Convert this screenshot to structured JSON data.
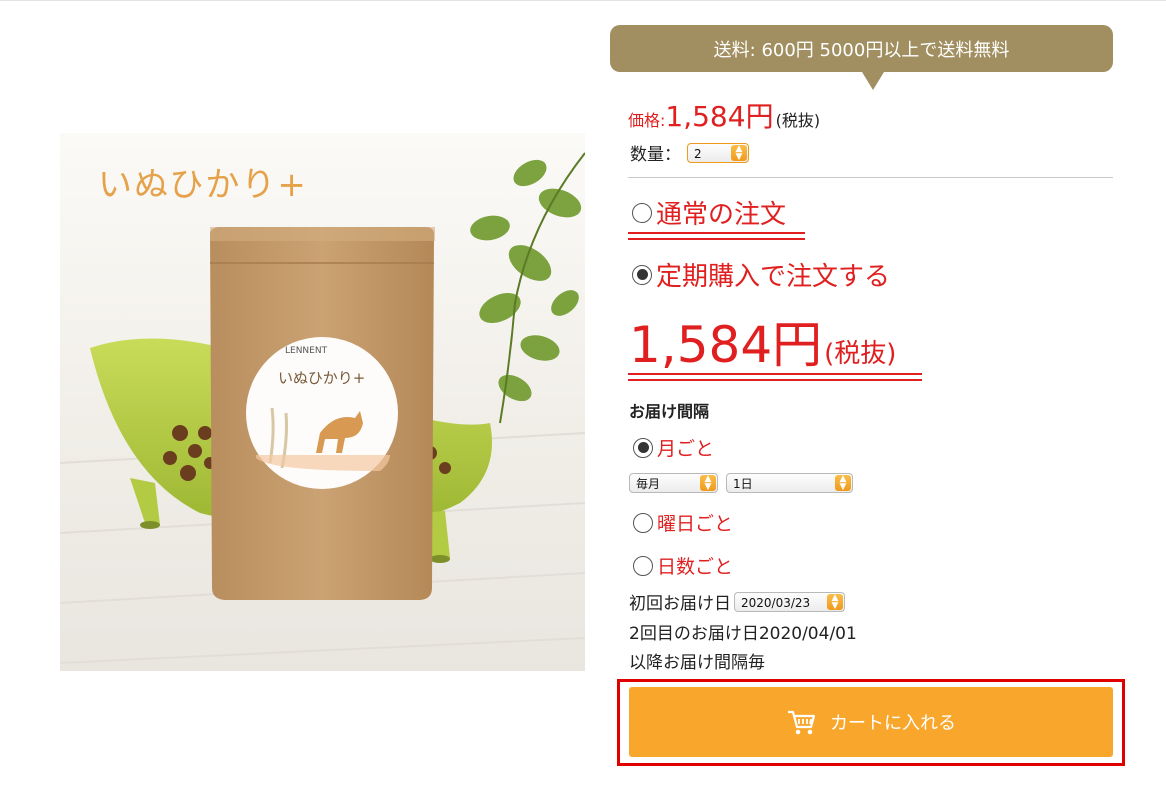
{
  "product": {
    "image_title": "いぬひかり+",
    "package_brand": "LENNENT",
    "package_name": "いぬひかり+"
  },
  "shipping": {
    "text": "送料: 600円 5000円以上で送料無料"
  },
  "price": {
    "label": "価格:",
    "value": "1,584円",
    "tax": "(税抜)"
  },
  "quantity": {
    "label": "数量：",
    "value": "2"
  },
  "order_type": {
    "normal_label": "通常の注文",
    "subscription_label": "定期購入で注文する",
    "selected": "subscription"
  },
  "subscription_price": {
    "amount": "1,584円",
    "tax": "(税抜)"
  },
  "delivery": {
    "heading": "お届け間隔",
    "monthly_label": "月ごと",
    "monthly_selected": true,
    "frequency_value": "毎月",
    "day_value": "1日",
    "weekday_label": "曜日ごと",
    "days_label": "日数ごと",
    "first_delivery_label": "初回お届け日",
    "first_delivery_date": "2020/03/23",
    "second_delivery_text": "2回目のお届け日2020/04/01",
    "interval_note": "以降お届け間隔毎"
  },
  "cart": {
    "button_label": "カートに入れる"
  },
  "colors": {
    "accent_red": "#e02020",
    "banner_gold": "#a18f61",
    "cart_orange": "#f9a72c",
    "outline_red": "#e00000"
  }
}
